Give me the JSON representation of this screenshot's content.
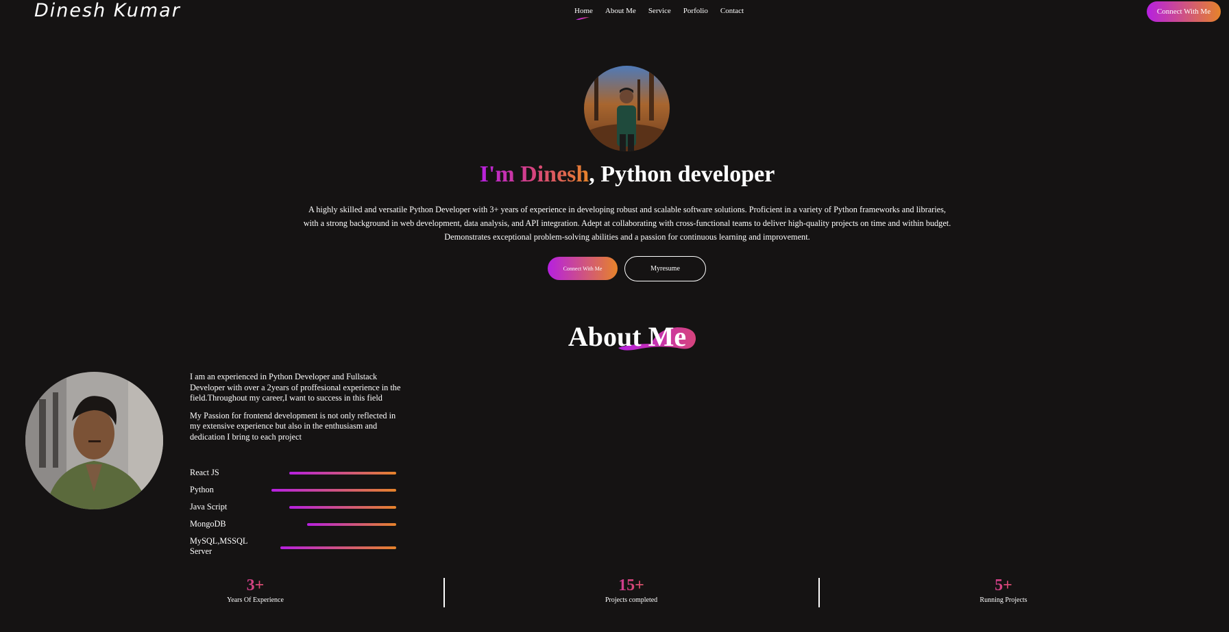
{
  "nav": {
    "logo": "Dinesh Kumar",
    "links": [
      "Home",
      "About Me",
      "Service",
      "Porfolio",
      "Contact"
    ],
    "cta": "Connect With Me"
  },
  "hero": {
    "title_highlight": "I'm Dinesh",
    "title_rest": ", Python developer",
    "description": "A highly skilled and versatile Python Developer with 3+ years of experience in developing robust and scalable software solutions. Proficient in a variety of Python frameworks and libraries, with a strong background in web development, data analysis, and API integration. Adept at collaborating with cross-functional teams to deliver high-quality projects on time and within budget. Demonstrates exceptional problem-solving abilities and a passion for continuous learning and improvement.",
    "connect_button": "Connect With Me",
    "resume_button": "Myresume"
  },
  "about": {
    "heading": "About Me",
    "paragraph1": "I am an experienced in Python Developer and Fullstack Developer with over a 2years of proffesional experience in the field.Throughout my career,I want to success in this field",
    "paragraph2": "My Passion for frontend development is not only reflected in my extensive experience but also in the enthusiasm and dedication I bring to each project",
    "skills": [
      {
        "name": "React JS",
        "level": 0.6
      },
      {
        "name": "Python",
        "level": 0.7
      },
      {
        "name": "Java Script",
        "level": 0.6
      },
      {
        "name": "MongoDB",
        "level": 0.5
      },
      {
        "name": "MySQL,MSSQL Server",
        "level": 0.65
      }
    ]
  },
  "stats": [
    {
      "number": "3+",
      "label": "Years Of Experience"
    },
    {
      "number": "15+",
      "label": "Projects completed"
    },
    {
      "number": "5+",
      "label": "Running Projects"
    }
  ],
  "colors": {
    "background": "#151313",
    "gradient_start": "#b620e0",
    "gradient_end": "#e6832a",
    "text": "#ffffff"
  }
}
